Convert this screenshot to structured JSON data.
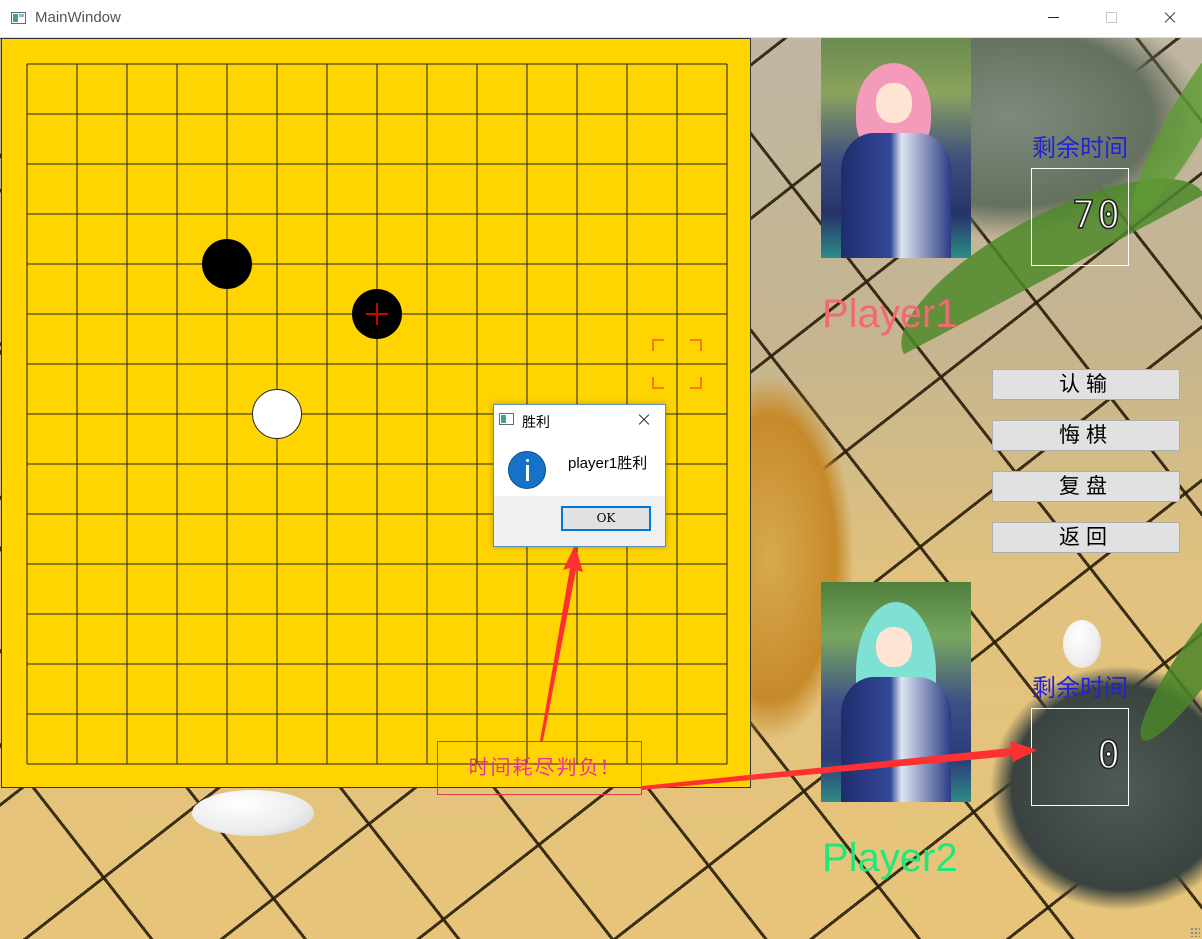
{
  "window": {
    "title": "MainWindow"
  },
  "board": {
    "size": 15,
    "stones": [
      {
        "color": "black",
        "col": 4,
        "row": 4,
        "last": false
      },
      {
        "color": "black",
        "col": 7,
        "row": 5,
        "last": true
      },
      {
        "color": "white",
        "col": 5,
        "row": 7,
        "last": false
      }
    ],
    "hover": {
      "col": 13,
      "row": 6
    }
  },
  "player1": {
    "name": "Player1",
    "timer_label": "剩余时间",
    "time_left": "70"
  },
  "player2": {
    "name": "Player2",
    "timer_label": "剩余时间",
    "time_left": "0"
  },
  "actions": {
    "resign": "认输",
    "undo": "悔棋",
    "replay": "复盘",
    "back": "返回"
  },
  "dialog": {
    "title": "胜利",
    "message": "player1胜利",
    "ok": "OK"
  },
  "annotation": {
    "text": "时间耗尽判负!"
  },
  "colors": {
    "board": "#ffd400",
    "player1_label": "#f06a76",
    "player2_label": "#21e67a",
    "timer_caption": "#2222d8",
    "annotation": "#f0309a",
    "arrow": "#ff3030",
    "last_move_marker": "#d40000",
    "hover_marker": "#ff7a00"
  }
}
